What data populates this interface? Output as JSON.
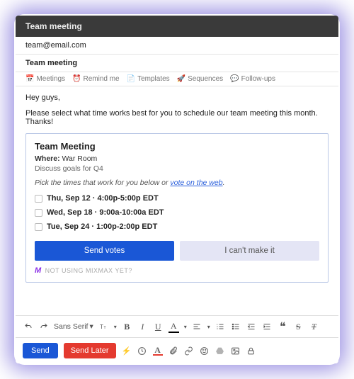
{
  "window": {
    "title": "Team meeting"
  },
  "fields": {
    "to": "team@email.com",
    "subject": "Team meeting"
  },
  "mixmax_bar": [
    {
      "icon": "📅",
      "label": "Meetings"
    },
    {
      "icon": "⏰",
      "label": "Remind me"
    },
    {
      "icon": "📄",
      "label": "Templates"
    },
    {
      "icon": "🚀",
      "label": "Sequences"
    },
    {
      "icon": "💬",
      "label": "Follow-ups"
    }
  ],
  "body": {
    "greeting": "Hey guys,",
    "line1": "Please select what time works best for you to schedule our team meeting this month. Thanks!"
  },
  "poll": {
    "title": "Team Meeting",
    "where_label": "Where:",
    "where_value": "War Room",
    "description": "Discuss goals for Q4",
    "pick_prefix": "Pick the times that work for you below or ",
    "pick_link": "vote on the web",
    "pick_suffix": ".",
    "slots": [
      "Thu, Sep 12 · 4:00p-5:00p EDT",
      "Wed, Sep 18 · 9:00a-10:00a EDT",
      "Tue, Sep 24 · 1:00p-2:00p EDT"
    ],
    "vote_btn": "Send votes",
    "cant_btn": "I can't make it",
    "promo": "NOT USING MIXMAX YET?",
    "promo_mark": "M"
  },
  "format": {
    "font": "Sans Serif"
  },
  "actions": {
    "send": "Send",
    "send_later": "Send Later"
  }
}
